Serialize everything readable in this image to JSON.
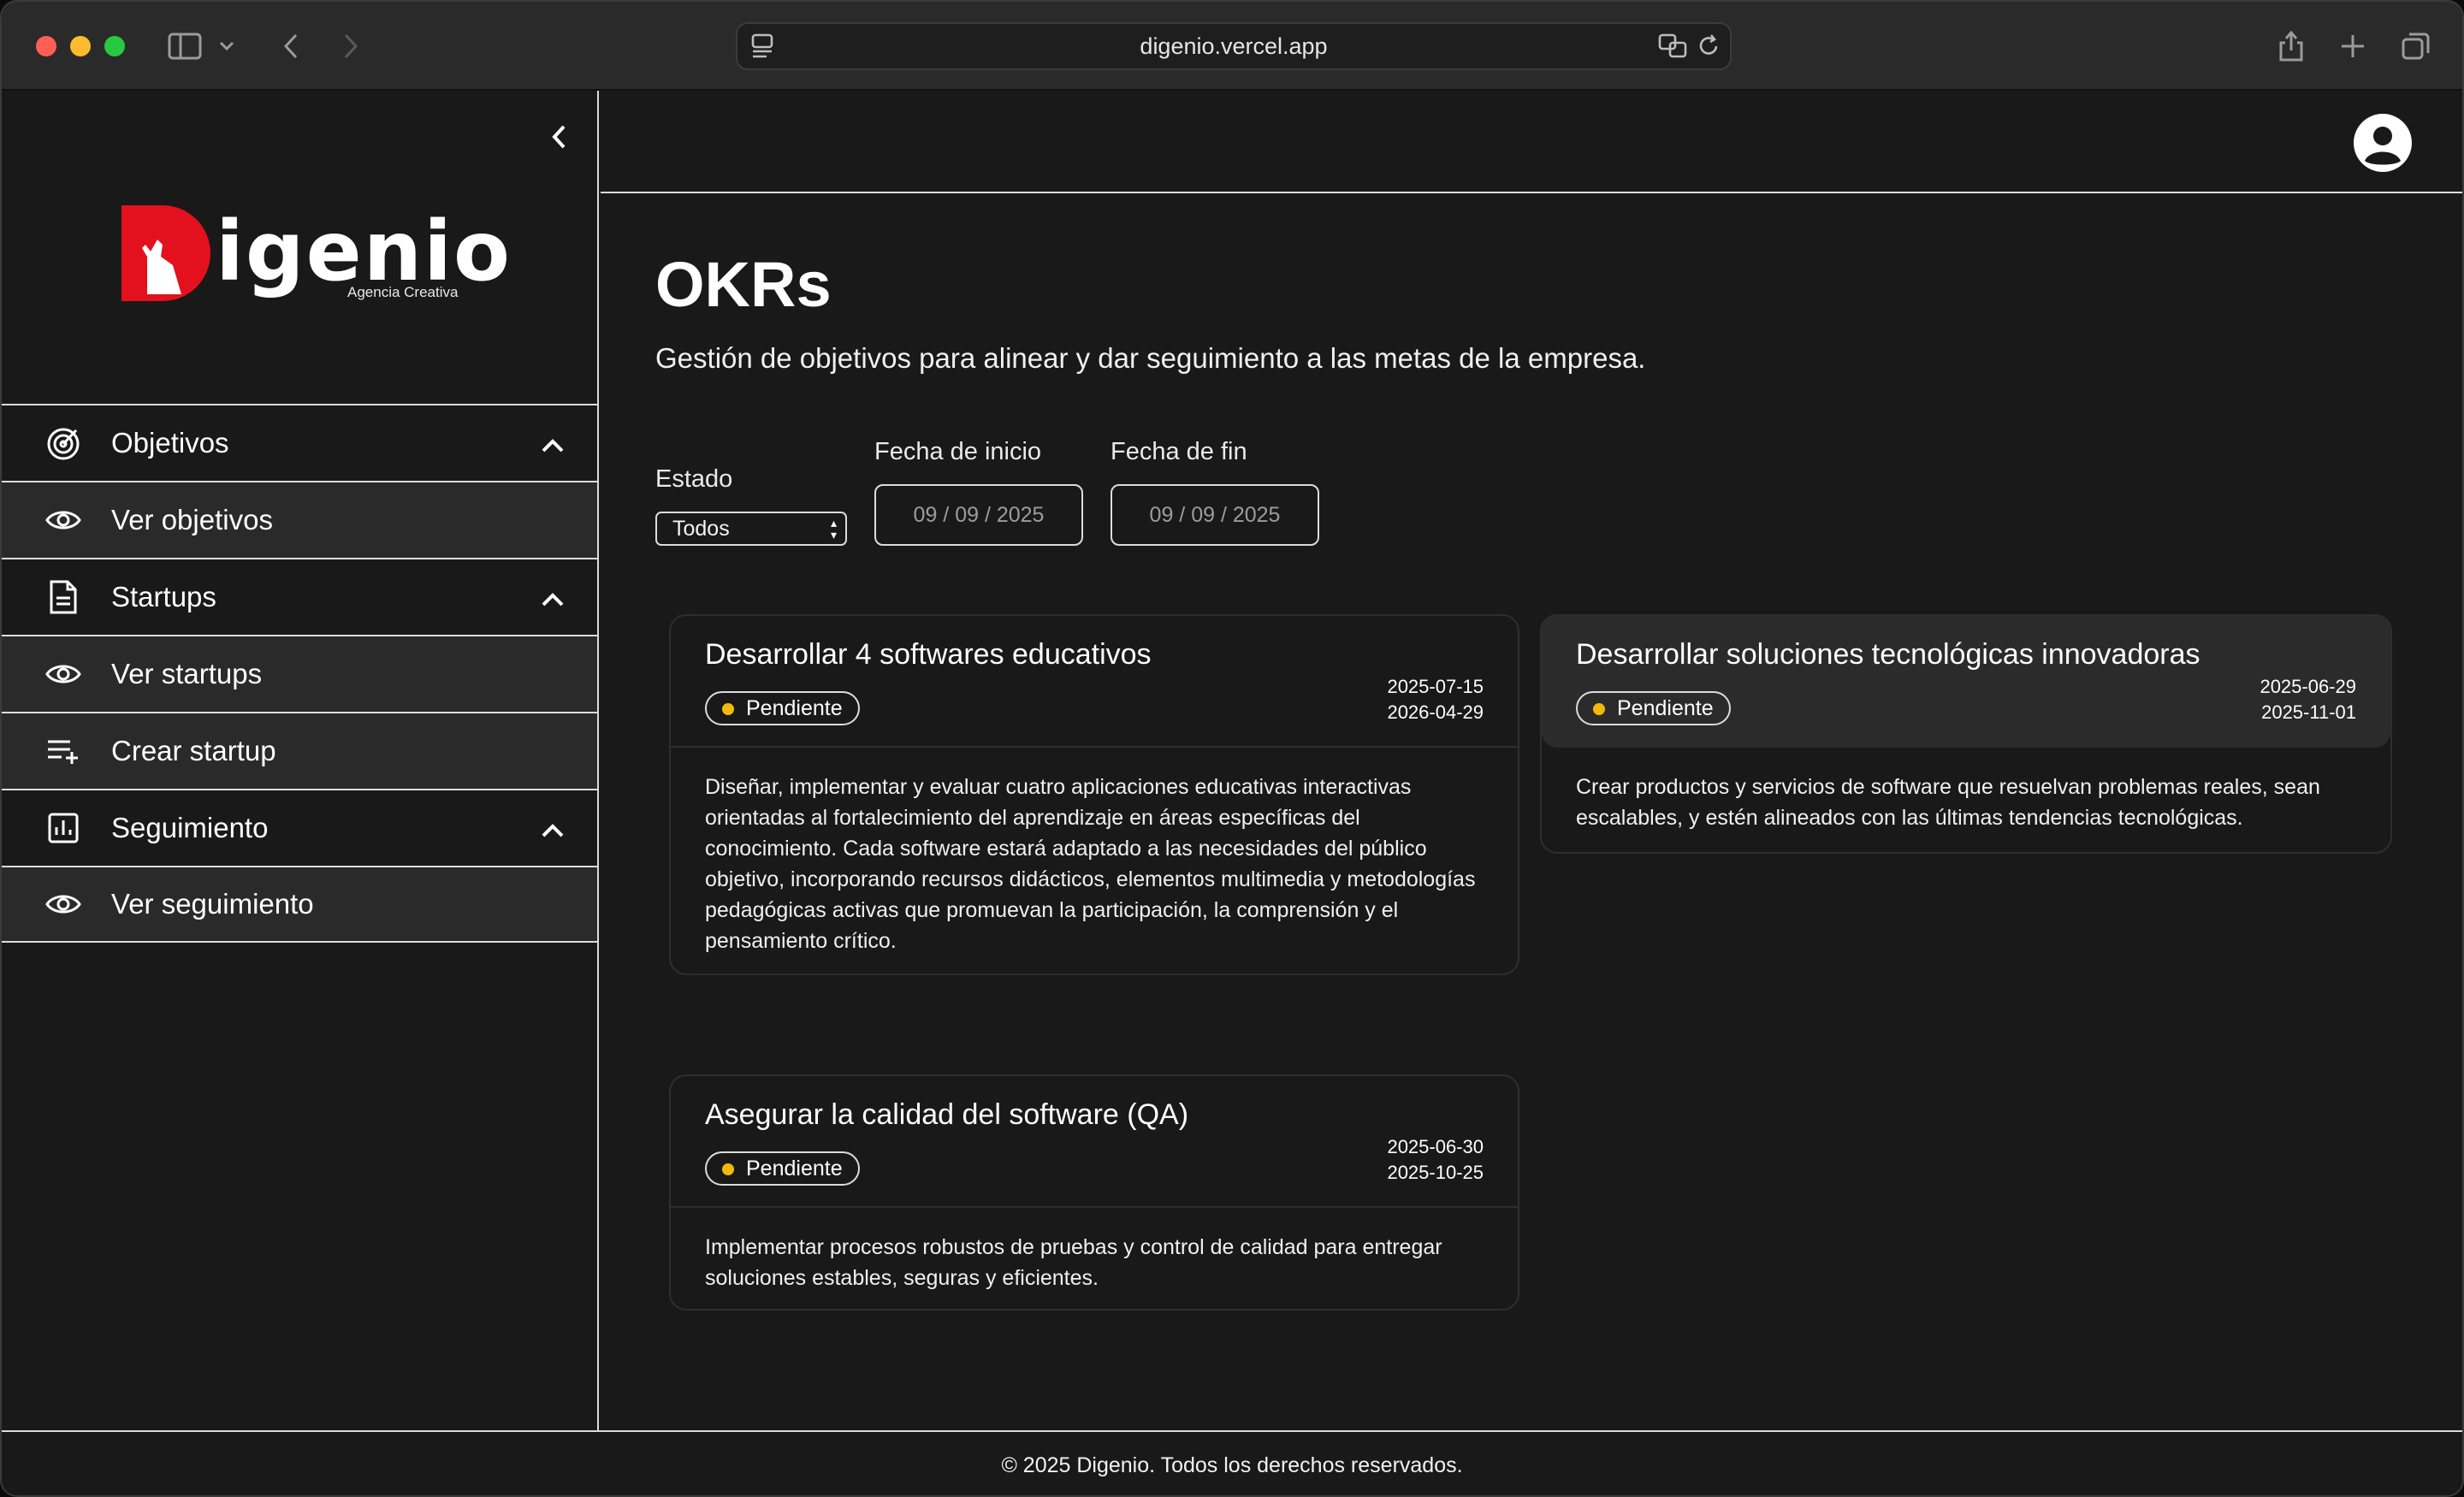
{
  "browser": {
    "url": "digenio.vercel.app"
  },
  "brand": {
    "name": "igenio",
    "tagline": "Agencia Creativa",
    "accent": "#e3101e"
  },
  "sidebar": {
    "items": [
      {
        "label": "Objetivos",
        "icon": "target-icon",
        "expanded": true
      },
      {
        "label": "Ver objetivos",
        "icon": "eye-icon"
      },
      {
        "label": "Startups",
        "icon": "document-icon",
        "expanded": true
      },
      {
        "label": "Ver startups",
        "icon": "eye-icon"
      },
      {
        "label": "Crear startup",
        "icon": "playlist-add-icon"
      },
      {
        "label": "Seguimiento",
        "icon": "chart-icon",
        "expanded": true
      },
      {
        "label": "Ver seguimiento",
        "icon": "eye-icon"
      }
    ]
  },
  "page": {
    "title": "OKRs",
    "description": "Gestión de objetivos para alinear y dar seguimiento a las metas de la empresa."
  },
  "filters": {
    "estado_label": "Estado",
    "estado_value": "Todos",
    "inicio_label": "Fecha de inicio",
    "inicio_value": "09 / 09 / 2025",
    "fin_label": "Fecha de fin",
    "fin_value": "09 / 09 / 2025"
  },
  "okrs": [
    {
      "title": "Desarrollar 4 softwares educativos",
      "status": "Pendiente",
      "start": "2025-07-15",
      "end": "2026-04-29",
      "description": "Diseñar, implementar y evaluar cuatro aplicaciones educativas interactivas orientadas al fortalecimiento del aprendizaje en áreas específicas del conocimiento. Cada software estará adaptado a las necesidades del público objetivo, incorporando recursos didácticos, elementos multimedia y metodologías pedagógicas activas que promuevan la participación, la comprensión y el pensamiento crítico."
    },
    {
      "title": "Desarrollar soluciones tecnológicas innovadoras",
      "status": "Pendiente",
      "start": "2025-06-29",
      "end": "2025-11-01",
      "description": "Crear productos y servicios de software que resuelvan problemas reales, sean escalables, y estén alineados con las últimas tendencias tecnológicas."
    },
    {
      "title": "Asegurar la calidad del software (QA)",
      "status": "Pendiente",
      "start": "2025-06-30",
      "end": "2025-10-25",
      "description": "Implementar procesos robustos de pruebas y control de calidad para entregar soluciones estables, seguras y eficientes."
    }
  ],
  "status_color": "#f2b90c",
  "footer": {
    "text": "© 2025 Digenio. Todos los derechos reservados."
  }
}
